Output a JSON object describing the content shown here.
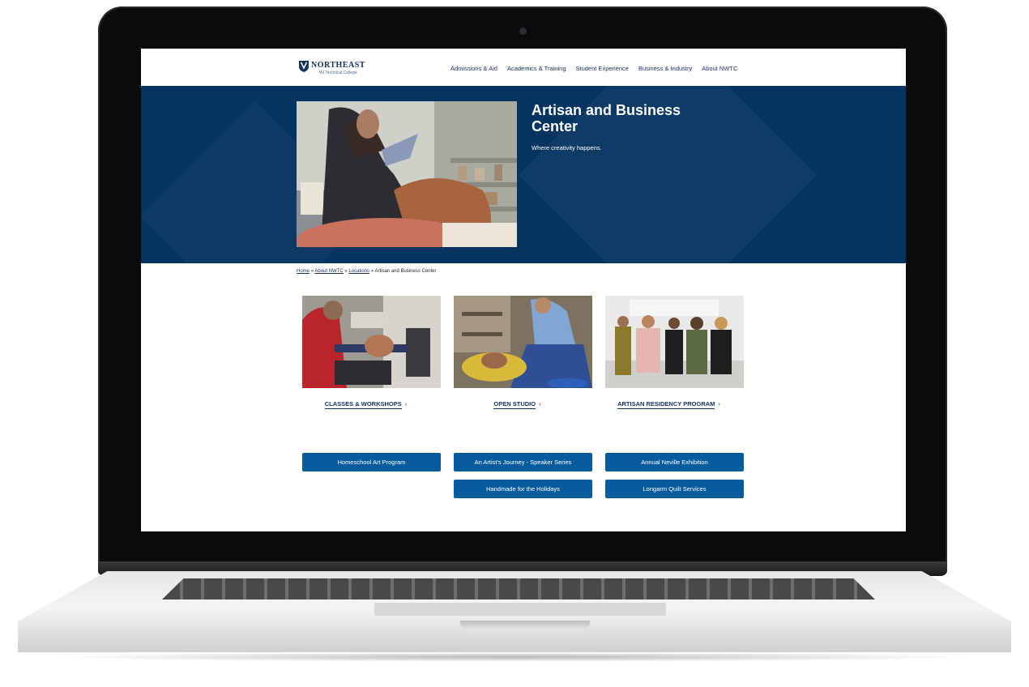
{
  "colors": {
    "navy": "#063461",
    "nav_text": "#13315f",
    "button_blue": "#075c9e",
    "chevron_red": "#d9342b"
  },
  "logo": {
    "name": "NORTHEAST",
    "subtitle": "WI Technical College"
  },
  "nav": {
    "items": [
      "Admissions & Aid",
      "Academics & Training",
      "Student Experience",
      "Business & Industry",
      "About NWTC"
    ]
  },
  "hero": {
    "title": "Artisan and Business Center",
    "subtitle": "Where creativity happens."
  },
  "breadcrumb": {
    "links": [
      "Home",
      "About NWTC",
      "Locations"
    ],
    "separator": "»",
    "current": "Artisan and Business Center"
  },
  "cards": [
    {
      "label": "CLASSES & WORKSHOPS",
      "chevron": "›"
    },
    {
      "label": "OPEN STUDIO",
      "chevron": "›"
    },
    {
      "label": "ARTISAN RESIDENCY PROGRAM",
      "chevron": "›"
    }
  ],
  "buttons": [
    "Homeschool Art Program",
    "An Artist's Journey - Speaker Series",
    "Annual Neville Exhibition",
    "Handmade for the Holidays",
    "Longarm Quilt Services"
  ]
}
